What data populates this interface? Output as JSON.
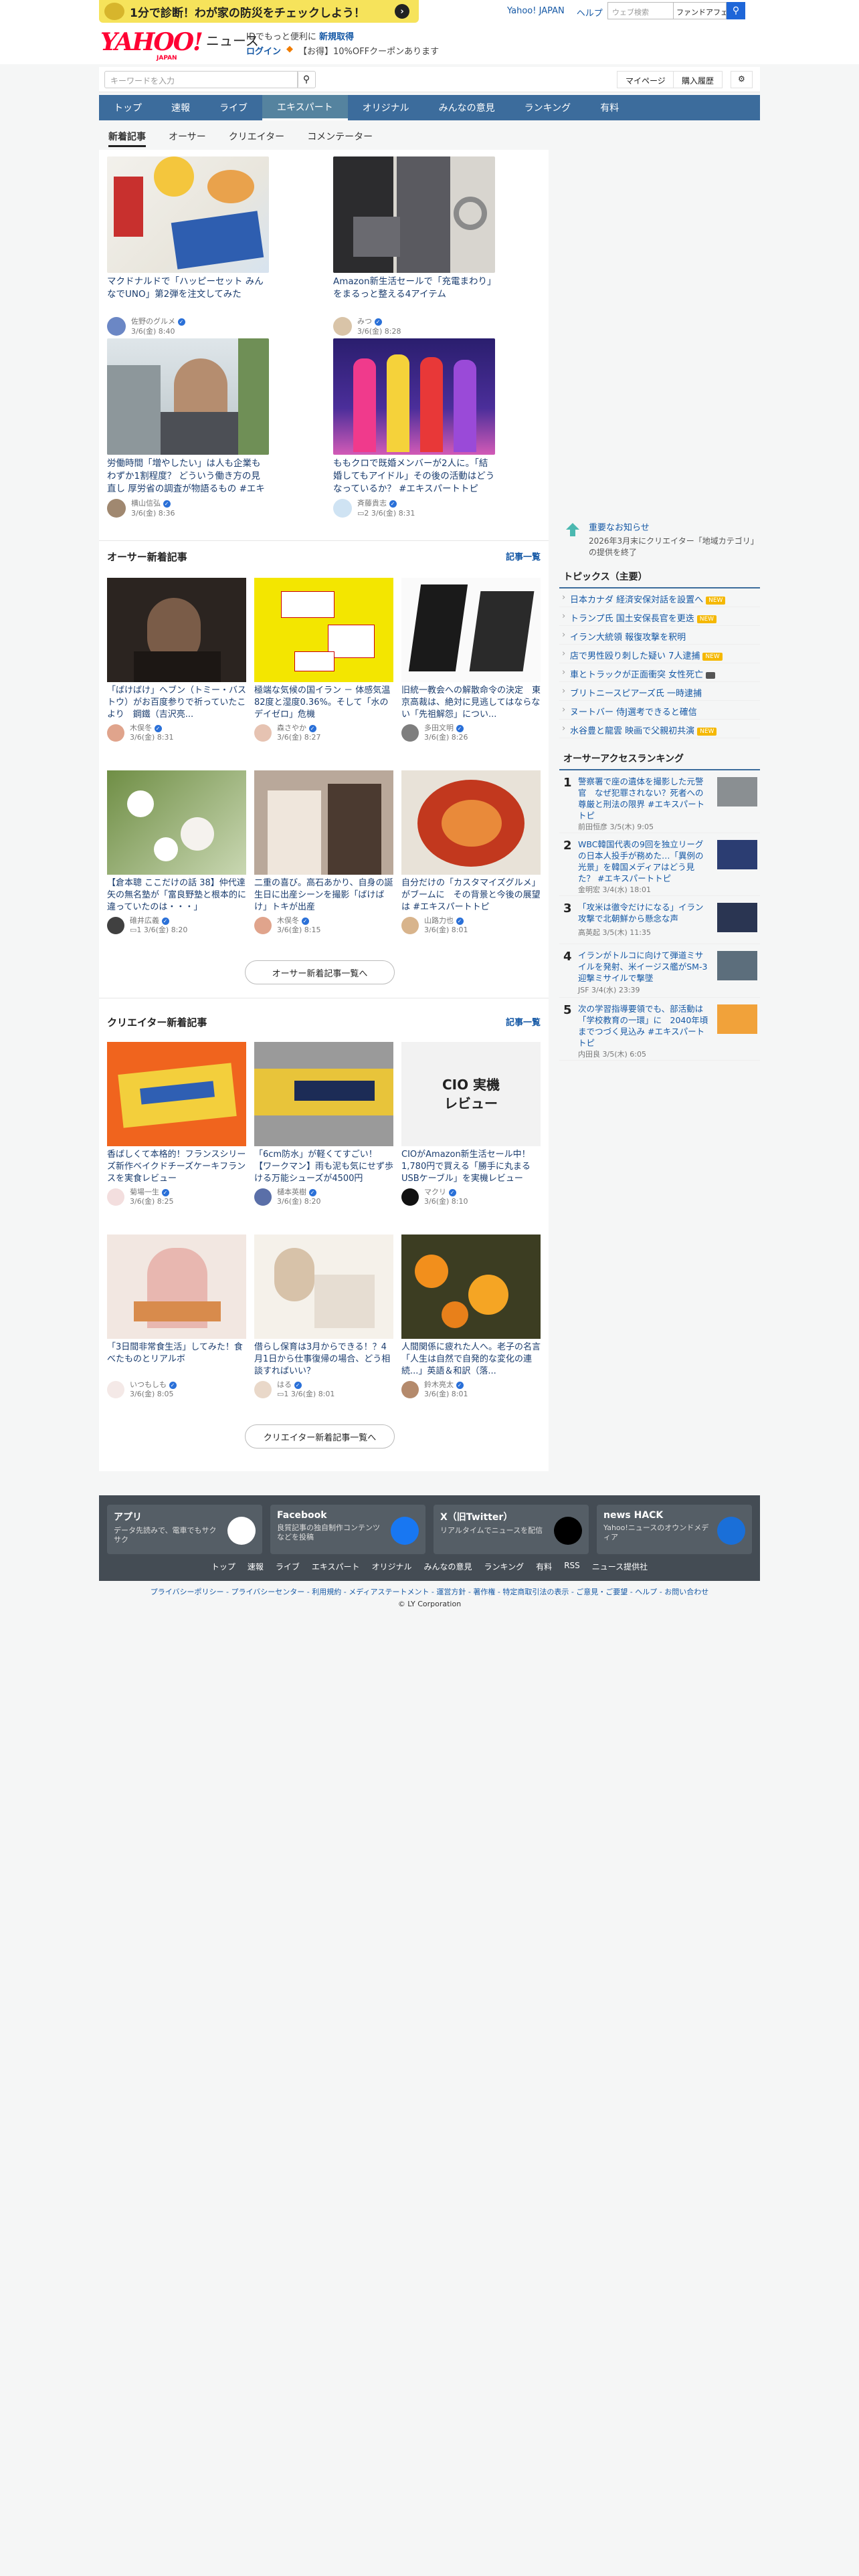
{
  "banner": {
    "text": "1分で診断！わが家の防災をチェックしよう！",
    "arrow": "›"
  },
  "header": {
    "links": [
      "Yahoo! JAPAN",
      "ヘルプ"
    ],
    "web_search_placeholder": "ウェブ検索",
    "fanfic": "ファンドアフェン",
    "logo": "YAHOO!",
    "logo_japan": "JAPAN",
    "logo_news": "ニュース",
    "promo1_pre": "IDでもっと便利に",
    "promo1_link": "新規取得",
    "promo2_login": "ログイン",
    "promo2_text": "【お得】10%OFFクーポンあります"
  },
  "searchbar": {
    "placeholder": "キーワードを入力",
    "mypage": "マイページ",
    "history": "購入履歴"
  },
  "nav": [
    "トップ",
    "速報",
    "ライブ",
    "エキスパート",
    "オリジナル",
    "みんなの意見",
    "ランキング",
    "有料"
  ],
  "subtabs": [
    "新着記事",
    "オーサー",
    "クリエイター",
    "コメンテーター"
  ],
  "featured": [
    {
      "title": "マクドナルドで「ハッピーセット みんなでUNO」第2弾を注文してみた",
      "author": "佐野のグルメ",
      "date": "3/6(金) 8:40"
    },
    {
      "title": "Amazon新生活セールで「充電まわり」をまるっと整える4アイテム",
      "author": "みつ",
      "date": "3/6(金) 8:28"
    },
    {
      "title": "労働時間「増やしたい」は人も企業もわずか1割程度？ どういう働き方の見直し 厚労省の調査が物語るもの #エキスパートトピ",
      "author": "横山信弘",
      "date": "3/6(金) 8:36"
    },
    {
      "title": "ももクロで既婚メンバーが2人に。「結婚してもアイドル」その後の活動はどうなっているか？ #エキスパートトピ",
      "author": "斉藤貴志",
      "date": "3/6(金) 8:31",
      "comments": "2"
    }
  ],
  "owner_section": {
    "title": "オーサー新着記事",
    "link": "記事一覧",
    "more": "オーサー新着記事一覧へ"
  },
  "owner": [
    {
      "title": "「ばけばけ」ヘブン（トミー・バストウ）がお百度参りで祈っていたこより　鋼鐵（吉沢亮...",
      "author": "木俣冬",
      "date": "3/6(金) 8:31"
    },
    {
      "title": "極端な気候の国イラン － 体感気温82度と湿度0.36%。そして「水のデイゼロ」危機",
      "author": "森さやか",
      "date": "3/6(金) 8:27"
    },
    {
      "title": "旧統一教会への解散命令の決定　東京高裁は、絶対に見逃してはならない「先祖解怨」につい...",
      "author": "多田文明",
      "date": "3/6(金) 8:26"
    },
    {
      "title": "【倉本聰 ここだけの話 38】仲代達矢の無名塾が「富良野塾と根本的に違っていたのは・・・」",
      "author": "碓井広義",
      "date": "3/6(金) 8:20",
      "comments": "1"
    },
    {
      "title": "二重の喜び。高石あかり、自身の誕生日に出産シーンを撮影「ばけばけ」トキが出産",
      "author": "木俣冬",
      "date": "3/6(金) 8:15"
    },
    {
      "title": "自分だけの「カスタマイズグルメ」がブームに　その背景と今後の展望は #エキスパートトピ",
      "author": "山路力也",
      "date": "3/6(金) 8:01"
    }
  ],
  "creator_section": {
    "title": "クリエイター新着記事",
    "link": "記事一覧",
    "more": "クリエイター新着記事一覧へ"
  },
  "creator": [
    {
      "title": "香ばしくて本格的！フランスシリーズ新作ベイクドチーズケーキフランスを実食レビュー",
      "author": "菊場一生",
      "date": "3/6(金) 8:25"
    },
    {
      "title": "「6cm防水」が軽くてすごい！【ワークマン】雨も泥も気にせず歩ける万能シューズが4500円",
      "author": "樋本英樹",
      "date": "3/6(金) 8:20"
    },
    {
      "title": "CIOがAmazon新生活セール中！1,780円で買える「勝手に丸まるUSBケーブル」を実機レビュー",
      "author": "マクリ",
      "date": "3/6(金) 8:10",
      "img_text": "CIO 実機レビュー"
    },
    {
      "title": "「3日間非常食生活」してみた！食べたものとリアルボ",
      "author": "いつもしも",
      "date": "3/6(金) 8:05"
    },
    {
      "title": "借らし保育は3月からできる！？4月1日から仕事復帰の場合、どう相談すればいい？",
      "author": "はる",
      "date": "3/6(金) 8:01",
      "comments": "1"
    },
    {
      "title": "人間関係に疲れた人へ。老子の名言「人生は自然で自発的な変化の連続...」英語＆和訳（落...",
      "author": "鈴木亮太",
      "date": "3/6(金) 8:01"
    }
  ],
  "notice": {
    "title": "重要なお知らせ",
    "text": "2026年3月末にクリエイター「地域カテゴリ」の提供を終了"
  },
  "topics": {
    "title": "トピックス（主要）",
    "items": [
      {
        "text": "日本カナダ 経済安保対話を設置へ",
        "new": true
      },
      {
        "text": "トランプ氏 国土安保長官を更迭",
        "new": true
      },
      {
        "text": "イラン大統領 報復攻撃を釈明",
        "new": false
      },
      {
        "text": "店で男性殴り刺した疑い 7人逮捕",
        "new": true
      },
      {
        "text": "車とトラックが正面衝突 女性死亡",
        "new": false,
        "cam": true
      },
      {
        "text": "ブリトニースピアーズ氏 一時逮捕",
        "new": false
      },
      {
        "text": "ヌートバー 侍J選考できると確信",
        "new": false
      },
      {
        "text": "水谷豊と龍雲 映画で父親初共演",
        "new": true
      }
    ],
    "new_label": "NEW"
  },
  "ranking": {
    "title": "オーサーアクセスランキング",
    "items": [
      {
        "rank": "1",
        "text": "警察署で座の遺体を撮影した元警官　なぜ犯罪されない？死者への尊厳と刑法の限界 #エキスパートトピ",
        "meta": "前田恒彦 3/5(木) 9:05"
      },
      {
        "rank": "2",
        "text": "WBC韓国代表の9回を独立リーグの日本人投手が務めた…「異例の光景」を韓国メディアはどう見た？ #エキスパートトピ",
        "meta": "金明宏 3/4(水) 18:01"
      },
      {
        "rank": "3",
        "text": "「攻米は徹令だけになる」イラン攻撃で北朝鮮から懸念な声",
        "meta": "高英起 3/5(木) 11:35"
      },
      {
        "rank": "4",
        "text": "イランがトルコに向けて弾道ミサイルを発射、米イージス艦がSM-3迎撃ミサイルで撃墜",
        "meta": "JSF 3/4(水) 23:39"
      },
      {
        "rank": "5",
        "text": "次の学習指導要領でも、部活動は「学校教育の一環」に　2040年頃までつづく見込み #エキスパートトピ",
        "meta": "内田良 3/5(木) 6:05"
      }
    ]
  },
  "footer": {
    "apps": [
      {
        "title": "アプリ",
        "desc": "データ先読みで、電車でもサクサク"
      },
      {
        "title": "Facebook",
        "desc": "良質記事の独自制作コンテンツなどを投稿"
      },
      {
        "title": "X（旧Twitter）",
        "desc": "リアルタイムでニュースを配信"
      },
      {
        "title": "news HACK",
        "desc": "Yahoo!ニュースのオウンドメディア"
      }
    ],
    "nav": [
      "トップ",
      "速報",
      "ライブ",
      "エキスパート",
      "オリジナル",
      "みんなの意見",
      "ランキング",
      "有料",
      "RSS",
      "ニュース提供社"
    ],
    "links": "プライバシーポリシー - プライバシーセンター - 利用規約 - メディアステートメント - 運営方針 - 著作権 - 特定商取引法の表示 - ご意見・ご要望 - ヘルプ - お問い合わせ",
    "copyright": "© LY Corporation"
  }
}
